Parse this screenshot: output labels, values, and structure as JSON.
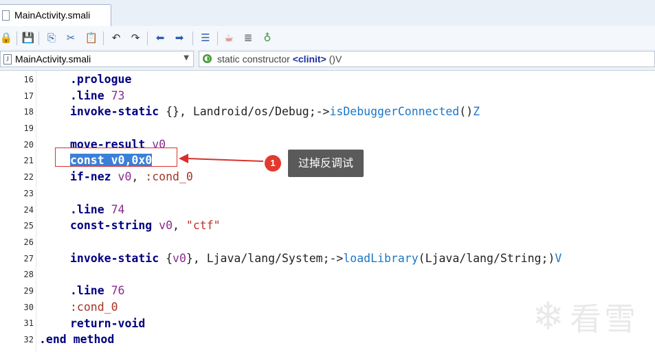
{
  "tab": {
    "label": "MainActivity.smali"
  },
  "toolbar": {
    "icons": [
      "lock-icon",
      "save-icon",
      "copy-icon",
      "cut-icon",
      "paste-icon",
      "undo-icon",
      "redo-icon",
      "back-icon",
      "forward-icon",
      "format-icon",
      "java-icon",
      "list-icon",
      "debug-icon"
    ]
  },
  "selectors": {
    "file": "MainActivity.smali",
    "method_prefix": "static constructor",
    "method_name": "<clinit>",
    "method_suffix": "()V"
  },
  "editor": {
    "lines": [
      "16",
      "17",
      "18",
      "19",
      "20",
      "21",
      "22",
      "23",
      "24",
      "25",
      "26",
      "27",
      "28",
      "29",
      "30",
      "31",
      "32"
    ],
    "code": {
      "l16": ".prologue",
      "l17a": ".line",
      "l17b": "73",
      "l18a": "invoke-static",
      "l18b": "{}, Landroid/os/Debug;->",
      "l18c": "isDebuggerConnected",
      "l18d": "()",
      "l18e": "Z",
      "l20a": "move-result",
      "l20b": "v0",
      "l21": "const v0,0x0",
      "l22a": "if-nez",
      "l22b": "v0",
      "l22c": ", ",
      "l22d": ":cond_0",
      "l24a": ".line",
      "l24b": "74",
      "l25a": "const-string",
      "l25b": "v0",
      "l25c": ", ",
      "l25d": "\"ctf\"",
      "l27a": "invoke-static",
      "l27b": "{",
      "l27c": "v0",
      "l27d": "}, Ljava/lang/System;->",
      "l27e": "loadLibrary",
      "l27f": "(Ljava/lang/String;)",
      "l27g": "V",
      "l29a": ".line",
      "l29b": "76",
      "l30": ":cond_0",
      "l31": "return-void",
      "l32": ".end method"
    }
  },
  "annotation": {
    "badge": "1",
    "text": "过掉反调试"
  },
  "watermark": {
    "text": "看雪"
  },
  "colors": {
    "selection": "#3a80d9",
    "keyword": "#000080",
    "callout_red": "#e23a2e"
  }
}
